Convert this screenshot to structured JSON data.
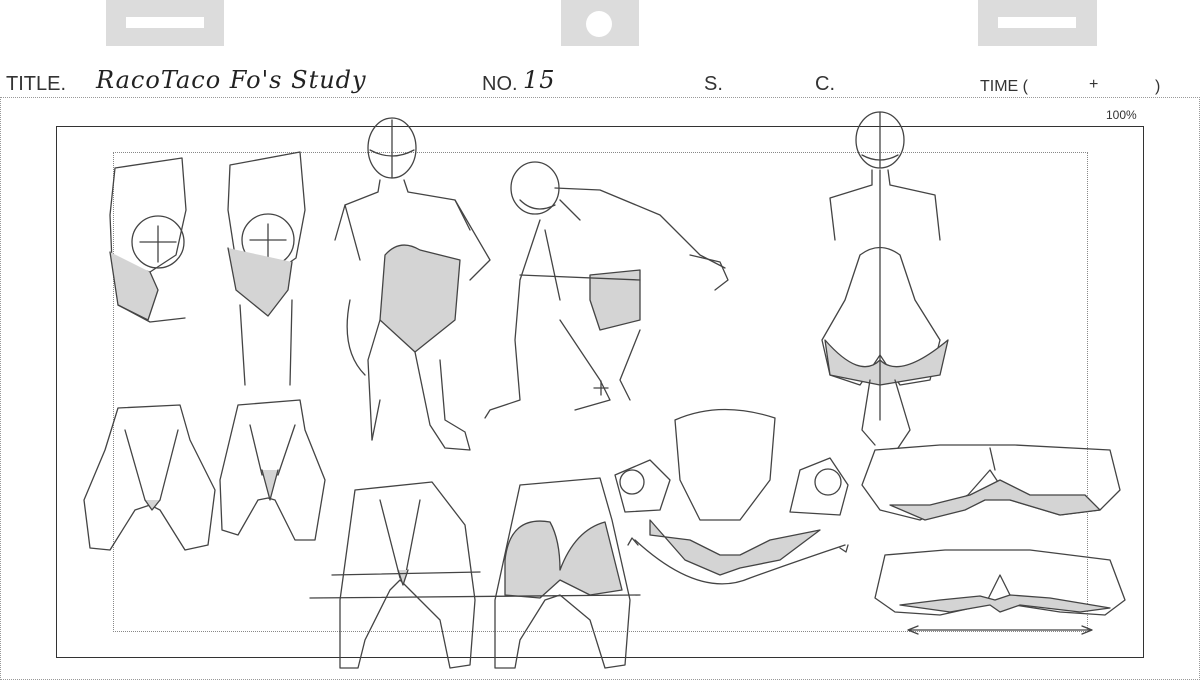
{
  "header": {
    "title_label": "TITLE.",
    "title_value": "RacoTaco Fo's Study",
    "number_label": "NO.",
    "number_value": "15",
    "scene_label": "S.",
    "cut_label": "C.",
    "time_label": "TIME (",
    "time_plus": "+",
    "time_close": ")"
  },
  "canvas": {
    "zoom": "100%"
  },
  "colors": {
    "tab": "#dcdcdc",
    "shade": "#d4d4d4",
    "line": "#333333"
  }
}
